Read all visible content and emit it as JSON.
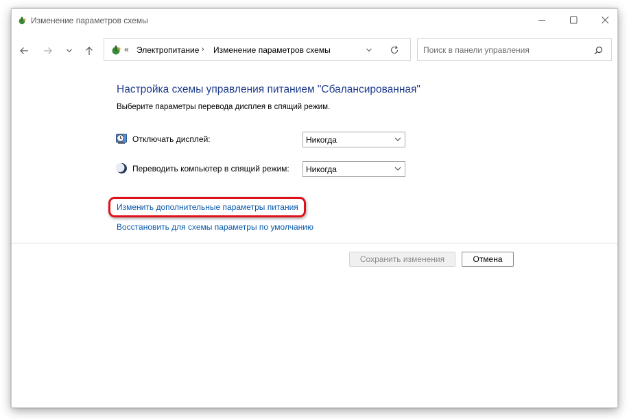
{
  "window": {
    "title": "Изменение параметров схемы"
  },
  "titlebar": {
    "minimize_icon": "minimize-icon",
    "maximize_icon": "maximize-icon",
    "close_icon": "close-icon"
  },
  "navigation": {
    "back_icon": "arrow-left-icon",
    "forward_icon": "arrow-right-icon",
    "recent_icon": "chevron-down-icon",
    "up_icon": "arrow-up-icon"
  },
  "address_bar": {
    "overflow": "«",
    "breadcrumbs": [
      "Электропитание",
      "Изменение параметров схемы"
    ],
    "separator": "›"
  },
  "search": {
    "placeholder": "Поиск в панели управления"
  },
  "main": {
    "heading": "Настройка схемы управления питанием \"Сбалансированная\"",
    "subheading": "Выберите параметры перевода дисплея в спящий режим.",
    "settings": [
      {
        "label": "Отключать дисплей:",
        "value": "Никогда",
        "icon": "display-timer-icon"
      },
      {
        "label": "Переводить компьютер в спящий режим:",
        "value": "Никогда",
        "icon": "sleep-moon-icon"
      }
    ],
    "links": {
      "advanced": "Изменить дополнительные параметры питания",
      "restore": "Восстановить для схемы параметры по умолчанию"
    }
  },
  "buttons": {
    "save": "Сохранить изменения",
    "cancel": "Отмена"
  },
  "colors": {
    "heading": "#1e3c8c",
    "link": "#0a5aac",
    "highlight": "#e0101a"
  }
}
